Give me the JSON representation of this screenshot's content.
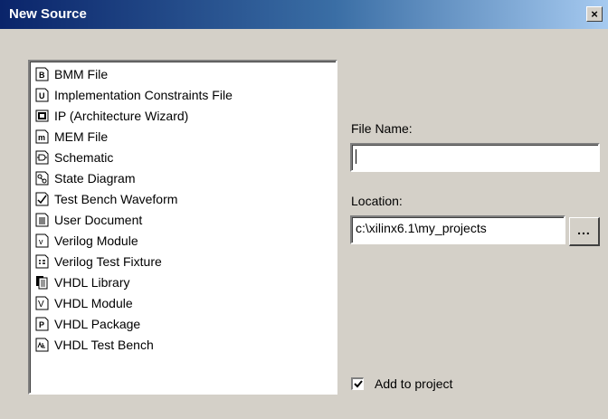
{
  "window": {
    "title": "New Source",
    "close_symbol": "×"
  },
  "source_list": {
    "items": [
      {
        "label": "BMM File",
        "icon": "bmm-file-icon"
      },
      {
        "label": "Implementation Constraints File",
        "icon": "constraints-file-icon"
      },
      {
        "label": "IP (Architecture Wizard)",
        "icon": "ip-wizard-icon"
      },
      {
        "label": "MEM File",
        "icon": "mem-file-icon"
      },
      {
        "label": "Schematic",
        "icon": "schematic-icon"
      },
      {
        "label": "State Diagram",
        "icon": "state-diagram-icon"
      },
      {
        "label": "Test Bench Waveform",
        "icon": "waveform-icon"
      },
      {
        "label": "User Document",
        "icon": "document-icon"
      },
      {
        "label": "Verilog Module",
        "icon": "verilog-module-icon"
      },
      {
        "label": "Verilog Test Fixture",
        "icon": "test-fixture-icon"
      },
      {
        "label": "VHDL Library",
        "icon": "library-icon"
      },
      {
        "label": "VHDL Module",
        "icon": "vhdl-module-icon"
      },
      {
        "label": "VHDL Package",
        "icon": "vhdl-package-icon"
      },
      {
        "label": "VHDL Test Bench",
        "icon": "test-bench-icon"
      }
    ]
  },
  "file_name": {
    "label": "File Name:",
    "value": ""
  },
  "location": {
    "label": "Location:",
    "value": "c:\\xilinx6.1\\my_projects",
    "browse_label": "..."
  },
  "add_to_project": {
    "label": "Add to project",
    "checked": true
  }
}
